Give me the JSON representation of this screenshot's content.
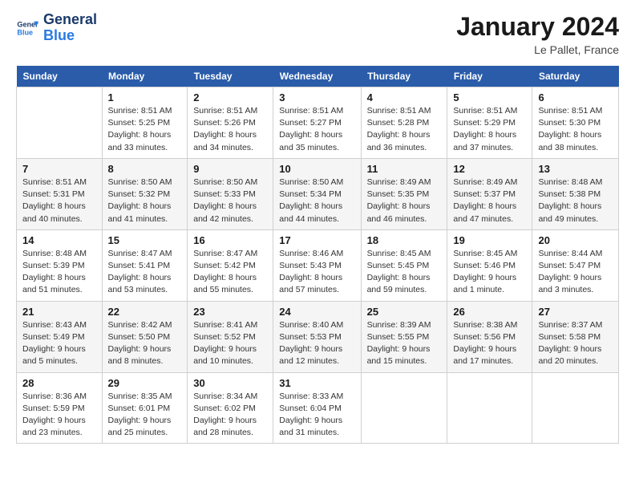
{
  "logo": {
    "text_general": "General",
    "text_blue": "Blue"
  },
  "header": {
    "month": "January 2024",
    "location": "Le Pallet, France"
  },
  "columns": [
    "Sunday",
    "Monday",
    "Tuesday",
    "Wednesday",
    "Thursday",
    "Friday",
    "Saturday"
  ],
  "weeks": [
    [
      {
        "day": "",
        "sunrise": "",
        "sunset": "",
        "daylight": ""
      },
      {
        "day": "1",
        "sunrise": "Sunrise: 8:51 AM",
        "sunset": "Sunset: 5:25 PM",
        "daylight": "Daylight: 8 hours and 33 minutes."
      },
      {
        "day": "2",
        "sunrise": "Sunrise: 8:51 AM",
        "sunset": "Sunset: 5:26 PM",
        "daylight": "Daylight: 8 hours and 34 minutes."
      },
      {
        "day": "3",
        "sunrise": "Sunrise: 8:51 AM",
        "sunset": "Sunset: 5:27 PM",
        "daylight": "Daylight: 8 hours and 35 minutes."
      },
      {
        "day": "4",
        "sunrise": "Sunrise: 8:51 AM",
        "sunset": "Sunset: 5:28 PM",
        "daylight": "Daylight: 8 hours and 36 minutes."
      },
      {
        "day": "5",
        "sunrise": "Sunrise: 8:51 AM",
        "sunset": "Sunset: 5:29 PM",
        "daylight": "Daylight: 8 hours and 37 minutes."
      },
      {
        "day": "6",
        "sunrise": "Sunrise: 8:51 AM",
        "sunset": "Sunset: 5:30 PM",
        "daylight": "Daylight: 8 hours and 38 minutes."
      }
    ],
    [
      {
        "day": "7",
        "sunrise": "Sunrise: 8:51 AM",
        "sunset": "Sunset: 5:31 PM",
        "daylight": "Daylight: 8 hours and 40 minutes."
      },
      {
        "day": "8",
        "sunrise": "Sunrise: 8:50 AM",
        "sunset": "Sunset: 5:32 PM",
        "daylight": "Daylight: 8 hours and 41 minutes."
      },
      {
        "day": "9",
        "sunrise": "Sunrise: 8:50 AM",
        "sunset": "Sunset: 5:33 PM",
        "daylight": "Daylight: 8 hours and 42 minutes."
      },
      {
        "day": "10",
        "sunrise": "Sunrise: 8:50 AM",
        "sunset": "Sunset: 5:34 PM",
        "daylight": "Daylight: 8 hours and 44 minutes."
      },
      {
        "day": "11",
        "sunrise": "Sunrise: 8:49 AM",
        "sunset": "Sunset: 5:35 PM",
        "daylight": "Daylight: 8 hours and 46 minutes."
      },
      {
        "day": "12",
        "sunrise": "Sunrise: 8:49 AM",
        "sunset": "Sunset: 5:37 PM",
        "daylight": "Daylight: 8 hours and 47 minutes."
      },
      {
        "day": "13",
        "sunrise": "Sunrise: 8:48 AM",
        "sunset": "Sunset: 5:38 PM",
        "daylight": "Daylight: 8 hours and 49 minutes."
      }
    ],
    [
      {
        "day": "14",
        "sunrise": "Sunrise: 8:48 AM",
        "sunset": "Sunset: 5:39 PM",
        "daylight": "Daylight: 8 hours and 51 minutes."
      },
      {
        "day": "15",
        "sunrise": "Sunrise: 8:47 AM",
        "sunset": "Sunset: 5:41 PM",
        "daylight": "Daylight: 8 hours and 53 minutes."
      },
      {
        "day": "16",
        "sunrise": "Sunrise: 8:47 AM",
        "sunset": "Sunset: 5:42 PM",
        "daylight": "Daylight: 8 hours and 55 minutes."
      },
      {
        "day": "17",
        "sunrise": "Sunrise: 8:46 AM",
        "sunset": "Sunset: 5:43 PM",
        "daylight": "Daylight: 8 hours and 57 minutes."
      },
      {
        "day": "18",
        "sunrise": "Sunrise: 8:45 AM",
        "sunset": "Sunset: 5:45 PM",
        "daylight": "Daylight: 8 hours and 59 minutes."
      },
      {
        "day": "19",
        "sunrise": "Sunrise: 8:45 AM",
        "sunset": "Sunset: 5:46 PM",
        "daylight": "Daylight: 9 hours and 1 minute."
      },
      {
        "day": "20",
        "sunrise": "Sunrise: 8:44 AM",
        "sunset": "Sunset: 5:47 PM",
        "daylight": "Daylight: 9 hours and 3 minutes."
      }
    ],
    [
      {
        "day": "21",
        "sunrise": "Sunrise: 8:43 AM",
        "sunset": "Sunset: 5:49 PM",
        "daylight": "Daylight: 9 hours and 5 minutes."
      },
      {
        "day": "22",
        "sunrise": "Sunrise: 8:42 AM",
        "sunset": "Sunset: 5:50 PM",
        "daylight": "Daylight: 9 hours and 8 minutes."
      },
      {
        "day": "23",
        "sunrise": "Sunrise: 8:41 AM",
        "sunset": "Sunset: 5:52 PM",
        "daylight": "Daylight: 9 hours and 10 minutes."
      },
      {
        "day": "24",
        "sunrise": "Sunrise: 8:40 AM",
        "sunset": "Sunset: 5:53 PM",
        "daylight": "Daylight: 9 hours and 12 minutes."
      },
      {
        "day": "25",
        "sunrise": "Sunrise: 8:39 AM",
        "sunset": "Sunset: 5:55 PM",
        "daylight": "Daylight: 9 hours and 15 minutes."
      },
      {
        "day": "26",
        "sunrise": "Sunrise: 8:38 AM",
        "sunset": "Sunset: 5:56 PM",
        "daylight": "Daylight: 9 hours and 17 minutes."
      },
      {
        "day": "27",
        "sunrise": "Sunrise: 8:37 AM",
        "sunset": "Sunset: 5:58 PM",
        "daylight": "Daylight: 9 hours and 20 minutes."
      }
    ],
    [
      {
        "day": "28",
        "sunrise": "Sunrise: 8:36 AM",
        "sunset": "Sunset: 5:59 PM",
        "daylight": "Daylight: 9 hours and 23 minutes."
      },
      {
        "day": "29",
        "sunrise": "Sunrise: 8:35 AM",
        "sunset": "Sunset: 6:01 PM",
        "daylight": "Daylight: 9 hours and 25 minutes."
      },
      {
        "day": "30",
        "sunrise": "Sunrise: 8:34 AM",
        "sunset": "Sunset: 6:02 PM",
        "daylight": "Daylight: 9 hours and 28 minutes."
      },
      {
        "day": "31",
        "sunrise": "Sunrise: 8:33 AM",
        "sunset": "Sunset: 6:04 PM",
        "daylight": "Daylight: 9 hours and 31 minutes."
      },
      {
        "day": "",
        "sunrise": "",
        "sunset": "",
        "daylight": ""
      },
      {
        "day": "",
        "sunrise": "",
        "sunset": "",
        "daylight": ""
      },
      {
        "day": "",
        "sunrise": "",
        "sunset": "",
        "daylight": ""
      }
    ]
  ]
}
